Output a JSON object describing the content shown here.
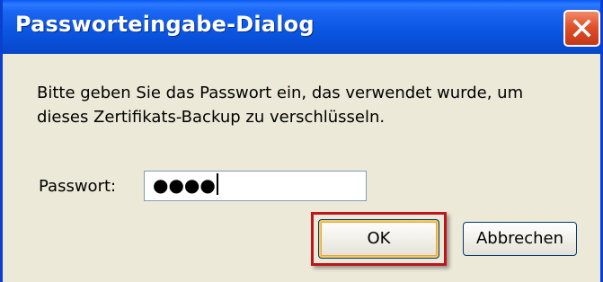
{
  "dialog": {
    "title": "Passworteingabe-Dialog",
    "message": "Bitte geben Sie das Passwort ein, das verwendet wurde, um dieses Zertifikats-Backup zu verschlüsseln.",
    "password_label": "Passwort:",
    "password_value": "●●●●",
    "ok_label": "OK",
    "cancel_label": "Abbrechen"
  },
  "icons": {
    "close": "close-icon"
  },
  "colors": {
    "titlebar": "#0a55e0",
    "close_button": "#e0512c",
    "dialog_background": "#ece9d8",
    "highlight_frame": "#c0141c"
  }
}
